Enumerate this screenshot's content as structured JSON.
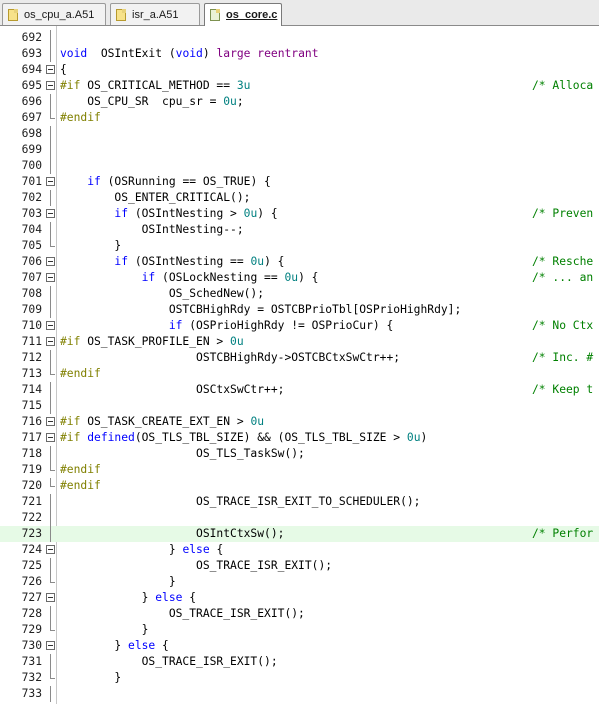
{
  "tabs": [
    {
      "label": "os_cpu_a.A51",
      "active": false
    },
    {
      "label": "isr_a.A51",
      "active": false
    },
    {
      "label": "os_core.c",
      "active": true
    }
  ],
  "editor": {
    "highlighted_line": "723",
    "lines": [
      {
        "n": "692",
        "fold": "bar",
        "code": "",
        "comment": ""
      },
      {
        "n": "693",
        "fold": "bar",
        "code": "void  OSIntExit (void) large reentrant",
        "comment": ""
      },
      {
        "n": "694",
        "fold": "box",
        "code": "{",
        "comment": ""
      },
      {
        "n": "695",
        "fold": "box",
        "code": "#if OS_CRITICAL_METHOD == 3u",
        "comment": "/* Alloca"
      },
      {
        "n": "696",
        "fold": "bar",
        "code": "    OS_CPU_SR  cpu_sr = 0u;",
        "comment": ""
      },
      {
        "n": "697",
        "fold": "end",
        "code": "#endif",
        "comment": ""
      },
      {
        "n": "698",
        "fold": "bar",
        "code": "",
        "comment": ""
      },
      {
        "n": "699",
        "fold": "bar",
        "code": "",
        "comment": ""
      },
      {
        "n": "700",
        "fold": "bar",
        "code": "",
        "comment": ""
      },
      {
        "n": "701",
        "fold": "box",
        "code": "    if (OSRunning == OS_TRUE) {",
        "comment": ""
      },
      {
        "n": "702",
        "fold": "bar",
        "code": "        OS_ENTER_CRITICAL();",
        "comment": ""
      },
      {
        "n": "703",
        "fold": "box",
        "code": "        if (OSIntNesting > 0u) {",
        "comment": "/* Preven"
      },
      {
        "n": "704",
        "fold": "bar",
        "code": "            OSIntNesting--;",
        "comment": ""
      },
      {
        "n": "705",
        "fold": "end",
        "code": "        }",
        "comment": ""
      },
      {
        "n": "706",
        "fold": "box",
        "code": "        if (OSIntNesting == 0u) {",
        "comment": "/* Resche"
      },
      {
        "n": "707",
        "fold": "box",
        "code": "            if (OSLockNesting == 0u) {",
        "comment": "/* ... an"
      },
      {
        "n": "708",
        "fold": "bar",
        "code": "                OS_SchedNew();",
        "comment": ""
      },
      {
        "n": "709",
        "fold": "bar",
        "code": "                OSTCBHighRdy = OSTCBPrioTbl[OSPrioHighRdy];",
        "comment": ""
      },
      {
        "n": "710",
        "fold": "box",
        "code": "                if (OSPrioHighRdy != OSPrioCur) {",
        "comment": "/* No Ctx"
      },
      {
        "n": "711",
        "fold": "box",
        "code": "#if OS_TASK_PROFILE_EN > 0u",
        "comment": ""
      },
      {
        "n": "712",
        "fold": "bar",
        "code": "                    OSTCBHighRdy->OSTCBCtxSwCtr++;",
        "comment": "/* Inc. #"
      },
      {
        "n": "713",
        "fold": "end",
        "code": "#endif",
        "comment": ""
      },
      {
        "n": "714",
        "fold": "bar",
        "code": "                    OSCtxSwCtr++;",
        "comment": "/* Keep t"
      },
      {
        "n": "715",
        "fold": "bar",
        "code": "",
        "comment": ""
      },
      {
        "n": "716",
        "fold": "box",
        "code": "#if OS_TASK_CREATE_EXT_EN > 0u",
        "comment": ""
      },
      {
        "n": "717",
        "fold": "box",
        "code": "#if defined(OS_TLS_TBL_SIZE) && (OS_TLS_TBL_SIZE > 0u)",
        "comment": ""
      },
      {
        "n": "718",
        "fold": "bar",
        "code": "                    OS_TLS_TaskSw();",
        "comment": ""
      },
      {
        "n": "719",
        "fold": "end",
        "code": "#endif",
        "comment": ""
      },
      {
        "n": "720",
        "fold": "end",
        "code": "#endif",
        "comment": ""
      },
      {
        "n": "721",
        "fold": "bar",
        "code": "                    OS_TRACE_ISR_EXIT_TO_SCHEDULER();",
        "comment": ""
      },
      {
        "n": "722",
        "fold": "bar",
        "code": "",
        "comment": ""
      },
      {
        "n": "723",
        "fold": "bar",
        "code": "                    OSIntCtxSw();",
        "comment": "/* Perfor"
      },
      {
        "n": "724",
        "fold": "box",
        "code": "                } else {",
        "comment": ""
      },
      {
        "n": "725",
        "fold": "bar",
        "code": "                    OS_TRACE_ISR_EXIT();",
        "comment": ""
      },
      {
        "n": "726",
        "fold": "end",
        "code": "                }",
        "comment": ""
      },
      {
        "n": "727",
        "fold": "box",
        "code": "            } else {",
        "comment": ""
      },
      {
        "n": "728",
        "fold": "bar",
        "code": "                OS_TRACE_ISR_EXIT();",
        "comment": ""
      },
      {
        "n": "729",
        "fold": "end",
        "code": "            }",
        "comment": ""
      },
      {
        "n": "730",
        "fold": "box",
        "code": "        } else {",
        "comment": ""
      },
      {
        "n": "731",
        "fold": "bar",
        "code": "            OS_TRACE_ISR_EXIT();",
        "comment": ""
      },
      {
        "n": "732",
        "fold": "end",
        "code": "        }",
        "comment": ""
      },
      {
        "n": "733",
        "fold": "bar",
        "code": "",
        "comment": ""
      }
    ]
  },
  "colors": {
    "keyword": "#0000ff",
    "number": "#008080",
    "preprocessor": "#808000",
    "comment": "#008000",
    "reserved": "#800080",
    "highlight_line": "#e6fae6"
  },
  "icons": {
    "tab_file": "file-icon",
    "fold_box": "fold-collapse-icon"
  }
}
